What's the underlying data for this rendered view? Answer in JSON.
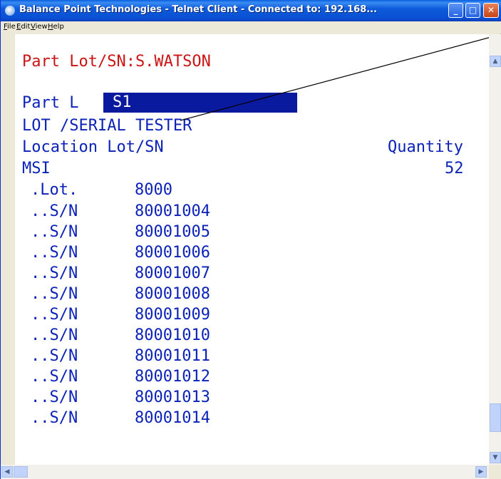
{
  "window": {
    "title": "Balance Point Technologies - Telnet Client - Connected to: 192.168...",
    "minimize_glyph": "_",
    "maximize_glyph": "□",
    "close_glyph": "✕"
  },
  "menu": [
    "File",
    "Edit",
    "View",
    "Help"
  ],
  "terminal": {
    "header": "Part Lot/SN:S.WATSON",
    "part_label": "Part L",
    "part_input": "S1",
    "description": "LOT /SERIAL TESTER",
    "col_location": "Location Lot/SN",
    "col_quantity": "Quantity",
    "location": "MSI",
    "quantity": "52",
    "lot_label": ".Lot.",
    "lot_value": "8000",
    "serials": [
      {
        "label": "..S/N",
        "value": "80001004"
      },
      {
        "label": "..S/N",
        "value": "80001005"
      },
      {
        "label": "..S/N",
        "value": "80001006"
      },
      {
        "label": "..S/N",
        "value": "80001007"
      },
      {
        "label": "..S/N",
        "value": "80001008"
      },
      {
        "label": "..S/N",
        "value": "80001009"
      },
      {
        "label": "..S/N",
        "value": "80001010"
      },
      {
        "label": "..S/N",
        "value": "80001011"
      },
      {
        "label": "..S/N",
        "value": "80001012"
      },
      {
        "label": "..S/N",
        "value": "80001013"
      },
      {
        "label": "..S/N",
        "value": "80001014"
      }
    ]
  },
  "colors": {
    "text": "#0b22b8",
    "header_text": "#cc1414",
    "highlight": "#0a1a9e",
    "titlebar": "#0950d4"
  }
}
